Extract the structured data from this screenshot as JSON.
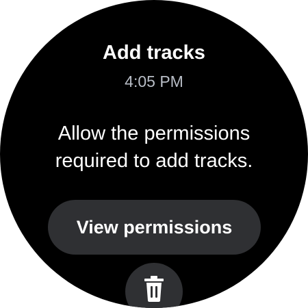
{
  "dialog": {
    "title": "Add tracks",
    "time": "4:05 PM",
    "message": "Allow the permissions required to add tracks."
  },
  "actions": {
    "primary_label": "View permissions",
    "secondary_icon": "trash-icon"
  },
  "colors": {
    "background": "#000000",
    "button": "#2f3033",
    "text": "#ffffff",
    "secondary_text": "#b9bec7"
  }
}
